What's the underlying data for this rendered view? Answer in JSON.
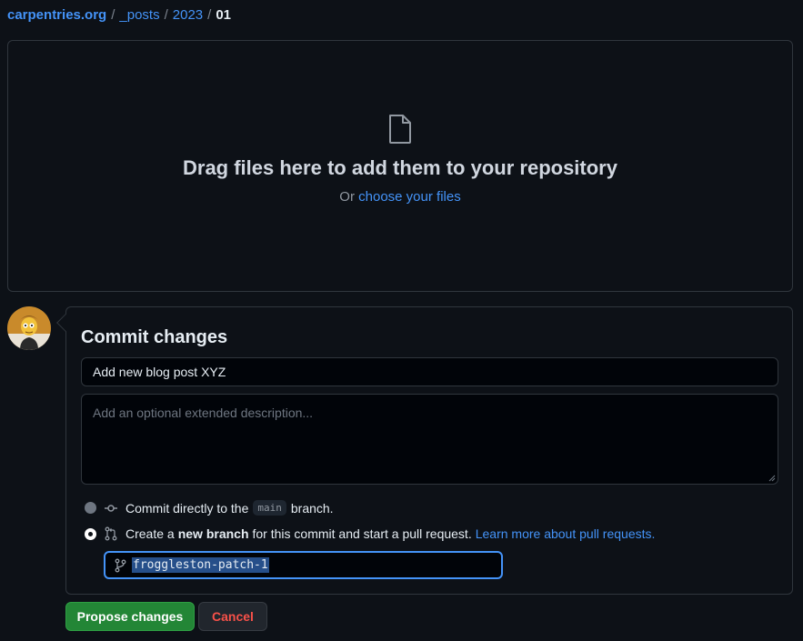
{
  "breadcrumb": {
    "repo": "carpentries.org",
    "segments": [
      "_posts",
      "2023"
    ],
    "current": "01",
    "separator": "/"
  },
  "dropzone": {
    "icon": "file-icon",
    "headline": "Drag files here to add them to your repository",
    "sub_prefix": "Or",
    "choose_link": "choose your files"
  },
  "commit": {
    "title": "Commit changes",
    "summary_value": "Add new blog post XYZ",
    "description_placeholder": "Add an optional extended description...",
    "option_direct": {
      "prefix": "Commit directly to the",
      "branch": "main",
      "suffix": "branch.",
      "selected": false
    },
    "option_new_branch": {
      "prefix": "Create a",
      "bold": "new branch",
      "suffix": "for this commit and start a pull request.",
      "link": "Learn more about pull requests.",
      "selected": true
    },
    "branch_name": "froggleston-patch-1"
  },
  "actions": {
    "propose": "Propose changes",
    "cancel": "Cancel"
  },
  "colors": {
    "accent": "#4493f8",
    "primary_button": "#238636",
    "danger": "#f85149",
    "background": "#0d1117"
  }
}
